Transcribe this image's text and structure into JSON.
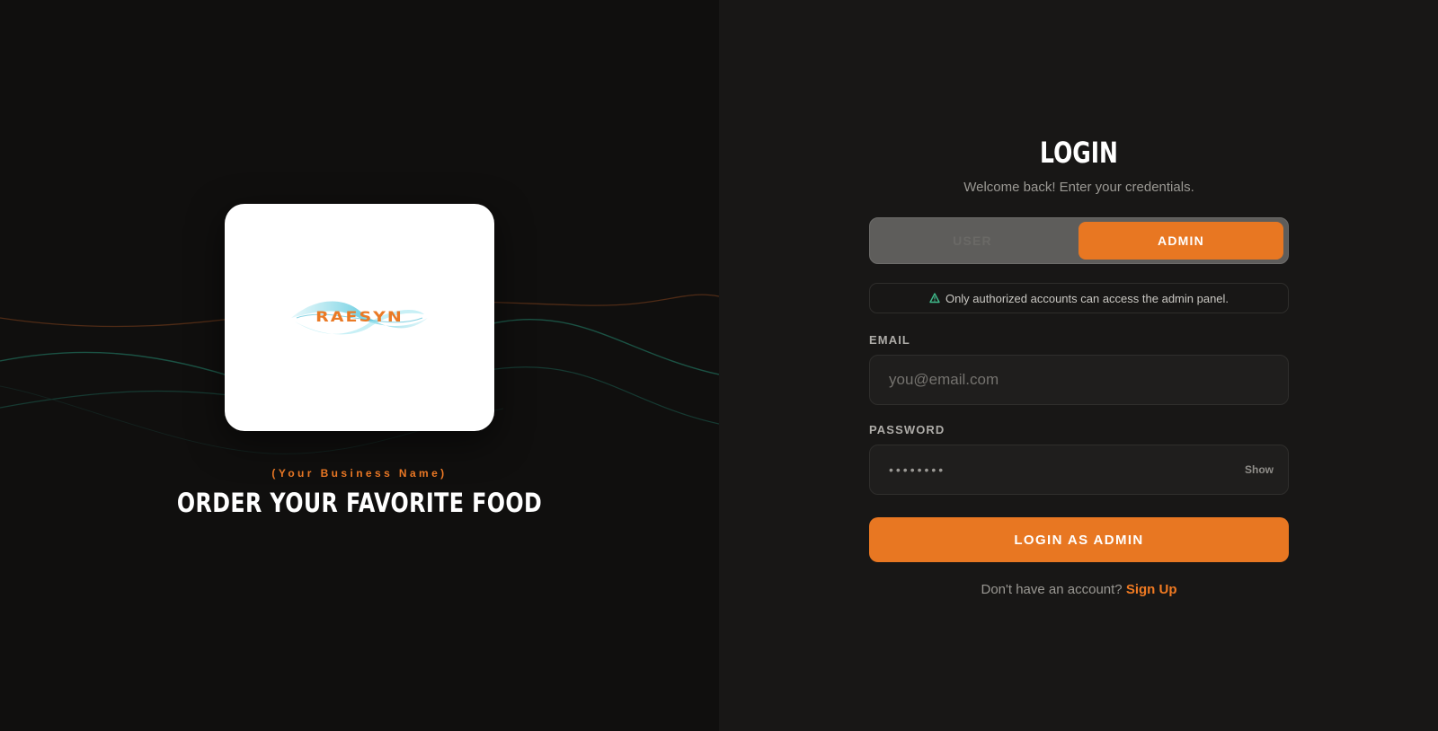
{
  "brand": {
    "logo_text": "RAESYN",
    "business_name": "(Your Business Name)",
    "tagline": "ORDER YOUR FAVORITE FOOD"
  },
  "login": {
    "title": "LOGIN",
    "subtitle": "Welcome back! Enter your credentials.",
    "tabs": {
      "user": "USER",
      "admin": "ADMIN",
      "active": "admin"
    },
    "notice": "Only authorized accounts can access the admin panel.",
    "email": {
      "label": "EMAIL",
      "placeholder": "you@email.com",
      "value": ""
    },
    "password": {
      "label": "PASSWORD",
      "value": "••••••••",
      "show_label": "Show"
    },
    "submit_label": "LOGIN AS ADMIN",
    "signup_prompt": "Don't have an account?",
    "signup_link": "Sign Up"
  },
  "colors": {
    "accent": "#e87722",
    "warning_icon": "#3fb98a"
  }
}
